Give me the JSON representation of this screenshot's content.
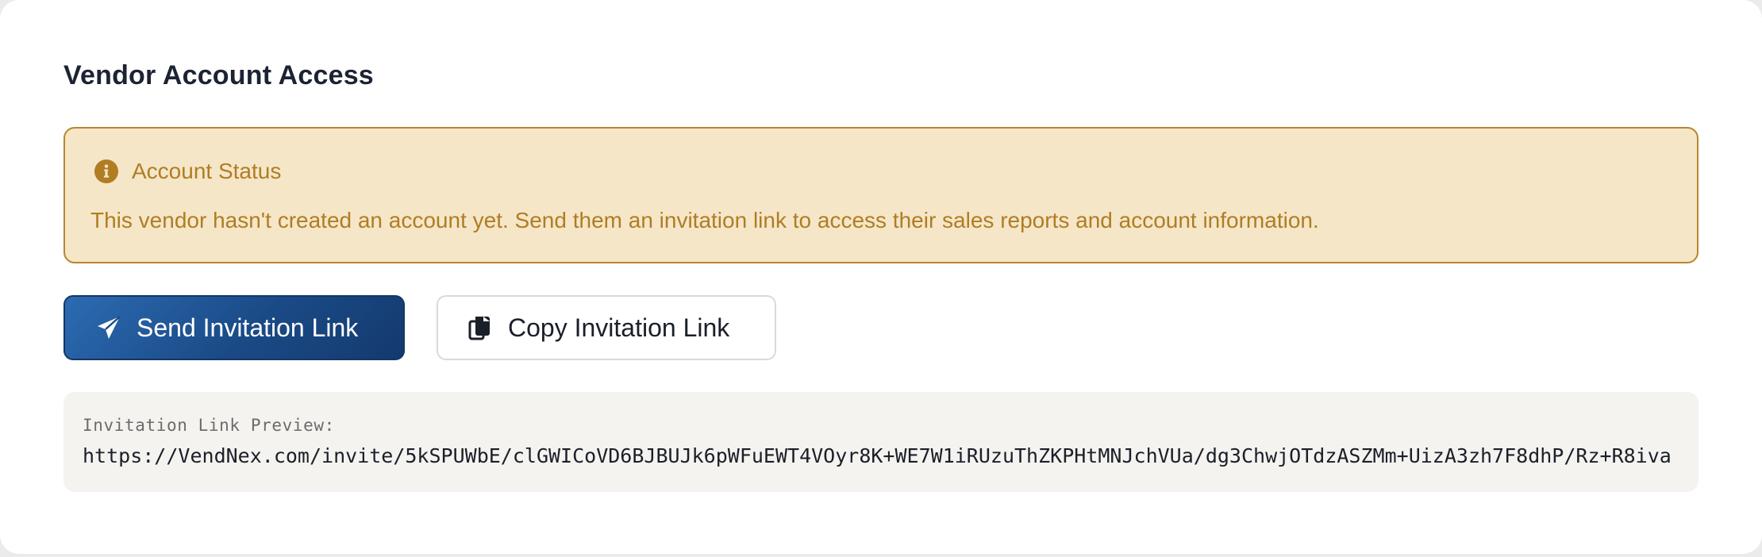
{
  "section": {
    "title": "Vendor Account Access"
  },
  "alert": {
    "icon": "info-circle-icon",
    "title": "Account Status",
    "message": "This vendor hasn't created an account yet. Send them an invitation link to access their sales reports and account information.",
    "colors": {
      "background": "#f5e6c8",
      "border": "#b8862e",
      "text": "#b07d23"
    }
  },
  "actions": {
    "send": {
      "icon": "paper-plane-icon",
      "label": "Send Invitation Link",
      "color": "#1a4a86"
    },
    "copy": {
      "icon": "copy-icon",
      "label": "Copy Invitation Link"
    }
  },
  "preview": {
    "label": "Invitation Link Preview:",
    "url": "https://VendNex.com/invite/5kSPUWbE/clGWICoVD6BJBUJk6pWFuEWT4VOyr8K+WE7W1iRUzuThZKPHtMNJchVUa/dg3ChwjOTdzASZMm+UizA3zh7F8dhP/Rz+R8iva"
  }
}
